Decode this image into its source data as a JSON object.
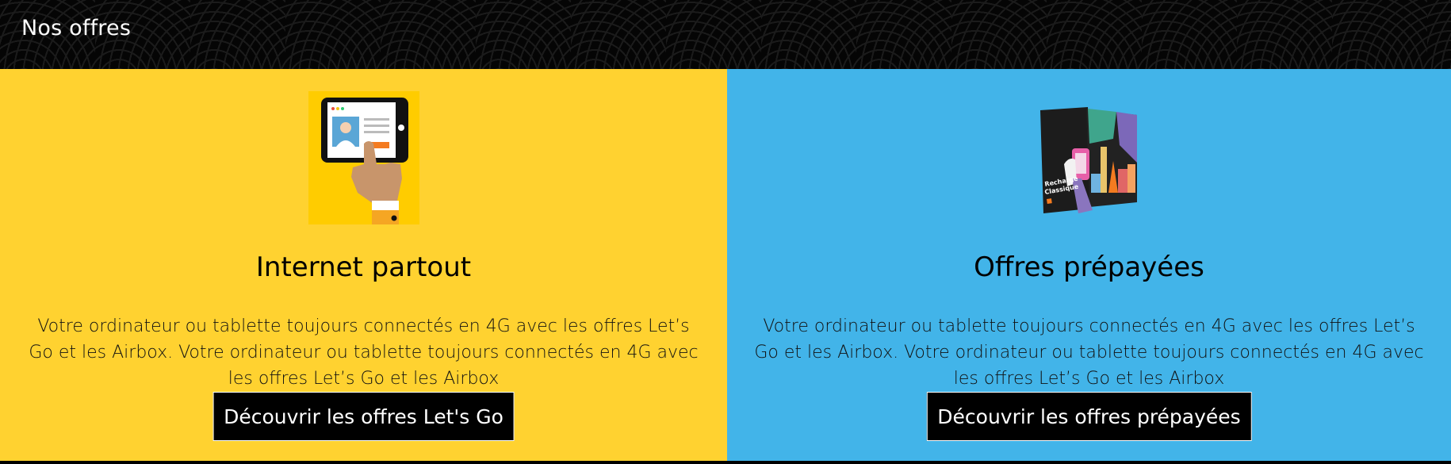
{
  "header": {
    "title": "Nos offres"
  },
  "colors": {
    "left_panel_bg": "#FFD230",
    "right_panel_bg": "#42B4E9",
    "button_bg": "#000000",
    "header_bg": "#050505"
  },
  "panels": [
    {
      "icon": "tablet-touch-icon",
      "title": "Internet partout",
      "description": "Votre ordinateur ou tablette toujours connectés en 4G avec les offres Let’s Go et les Airbox. Votre ordinateur ou tablette toujours connectés en 4G avec les offres Let’s Go et les Airbox",
      "button": "Découvrir les offres Let's Go"
    },
    {
      "icon": "prepaid-card-icon",
      "title": "Offres prépayées",
      "description": "Votre ordinateur ou tablette toujours connectés en 4G avec les offres Let’s Go et les Airbox. Votre ordinateur ou tablette toujours connectés en 4G avec les offres Let’s Go et les Airbox",
      "button": "Découvrir les offres prépayées",
      "card_text": [
        "Recharge",
        "Classique"
      ]
    }
  ]
}
